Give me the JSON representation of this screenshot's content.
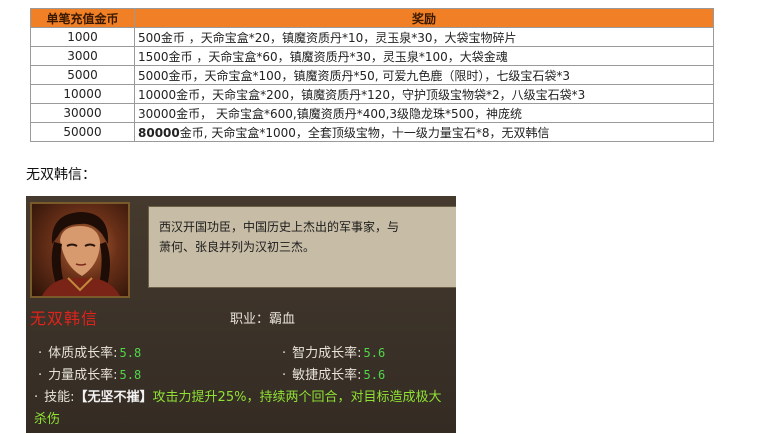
{
  "table": {
    "header": {
      "amount": "单笔充值金币",
      "reward": "奖励"
    },
    "rows": [
      {
        "amount": "1000",
        "reward_bold": "",
        "reward": "500金币 ，天命宝盒*20，镇魔资质丹*10，灵玉泉*30，大袋宝物碎片"
      },
      {
        "amount": "3000",
        "reward_bold": "",
        "reward": "1500金币 ，天命宝盒*60，镇魔资质丹*30，灵玉泉*100，大袋金魂"
      },
      {
        "amount": "5000",
        "reward_bold": "",
        "reward": "5000金币，天命宝盒*100，镇魔资质丹*50, 可爱九色鹿（限时），七级宝石袋*3"
      },
      {
        "amount": "10000",
        "reward_bold": "",
        "reward": "10000金币，天命宝盒*200，镇魔资质丹*120，守护顶级宝物袋*2，八级宝石袋*3"
      },
      {
        "amount": "30000",
        "reward_bold": "",
        "reward": "30000金币， 天命宝盒*600,镇魔资质丹*400,3级隐龙珠*500，神庞统"
      },
      {
        "amount": "50000",
        "reward_bold": "80000",
        "reward": "金币, 天命宝盒*1000，全套顶级宝物，十一级力量宝石*8，无双韩信"
      }
    ]
  },
  "caption": "无双韩信：",
  "card": {
    "portrait_icon": "hero-portrait-icon",
    "description": [
      "西汉开国功臣，中国历史上杰出的军事家，与",
      "萧何、张良并列为汉初三杰。"
    ],
    "name": "无双韩信",
    "job_label": "职业：",
    "job_value": "霸血",
    "bullet": "·",
    "stats": {
      "constitution": {
        "label": "体质成长率:",
        "value": "5.8"
      },
      "intellect": {
        "label": "智力成长率:",
        "value": "5.6"
      },
      "strength": {
        "label": "力量成长率:",
        "value": "5.8"
      },
      "agility": {
        "label": "敏捷成长率:",
        "value": "5.6"
      }
    },
    "skill": {
      "label": "技能:",
      "name": "【无坚不摧】",
      "desc": "攻击力提升25%，持续两个回合，对目标造成极大杀伤"
    }
  },
  "colors": {
    "header_bg": "#f07f25",
    "card_bg": "#3e342a",
    "name_red": "#e0231b",
    "value_green": "#52d64a",
    "skill_green": "#8fe234"
  }
}
